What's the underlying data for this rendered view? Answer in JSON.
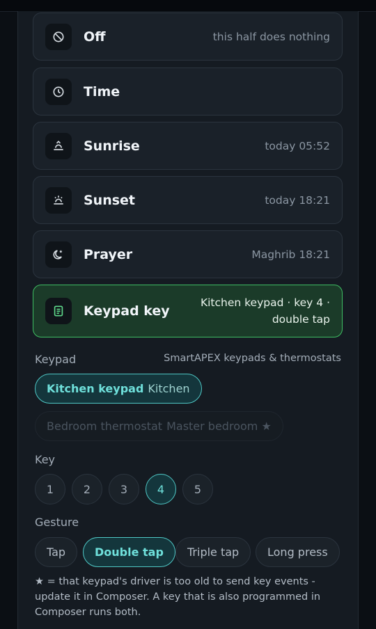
{
  "triggers": [
    {
      "label": "Off",
      "detail": "this half does nothing",
      "icon": "ban-icon"
    },
    {
      "label": "Time",
      "detail": "",
      "icon": "clock-icon"
    },
    {
      "label": "Sunrise",
      "detail": "today 05:52",
      "icon": "sunrise-icon"
    },
    {
      "label": "Sunset",
      "detail": "today 18:21",
      "icon": "sunset-icon"
    },
    {
      "label": "Prayer",
      "detail": "Maghrib 18:21",
      "icon": "moon-star-icon"
    },
    {
      "label": "Keypad key",
      "detail": "Kitchen keypad · key 4 · double tap",
      "icon": "keypad-icon",
      "selected": true
    }
  ],
  "keypad": {
    "label": "Keypad",
    "hint": "SmartAPEX keypads & thermostats",
    "options": [
      {
        "name": "Kitchen keypad",
        "room": "Kitchen",
        "selected": true
      },
      {
        "name": "Bedroom thermostat",
        "room": "Master bedroom ★",
        "disabled": true
      }
    ]
  },
  "key": {
    "label": "Key",
    "options": [
      "1",
      "2",
      "3",
      "4",
      "5"
    ],
    "selected": "4"
  },
  "gesture": {
    "label": "Gesture",
    "options": [
      "Tap",
      "Double tap",
      "Triple tap",
      "Long press"
    ],
    "selected": "Double tap"
  },
  "note": "★ = that keypad's driver is too old to send key events - update it in Composer. A key that is also programmed in Composer runs both.",
  "colors": {
    "accent": "#4fc7c5",
    "active_card": "#1b3b29",
    "active_border": "#3fbf63"
  }
}
